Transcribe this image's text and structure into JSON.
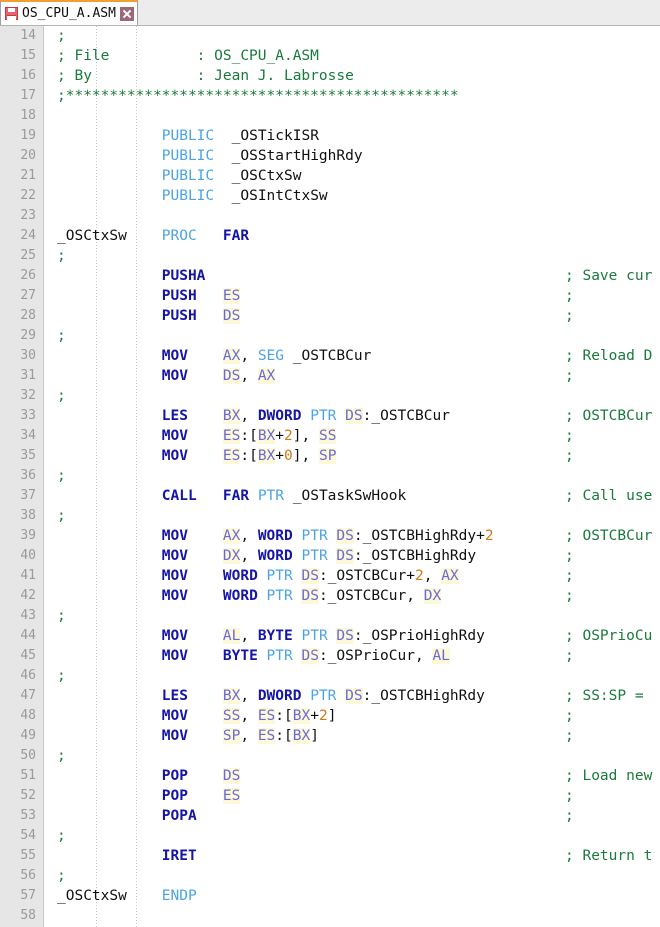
{
  "tab": {
    "label": "OS_CPU_A.ASM",
    "icon": "floppy-disk-icon",
    "close_icon": "close-icon",
    "modified": true
  },
  "colors": {
    "comment": "#1a7a3c",
    "directive": "#4ba3e3",
    "mnemonic": "#1515a8",
    "register_text": "#6a6ad6",
    "register_highlight": "#fcf8d8",
    "number": "#d07a1a",
    "identifier": "#101010",
    "gutter_bg": "#e6e6e6",
    "gutter_fg": "#9a9a9a",
    "tab_active_border": "#f0a030",
    "editor_bg": "#ffffff"
  },
  "editor": {
    "first_line": 14,
    "last_line": 58,
    "line_height": 20,
    "lines": [
      {
        "n": 14,
        "tokens": [
          {
            "t": ";",
            "c": "com"
          }
        ]
      },
      {
        "n": 15,
        "tokens": [
          {
            "t": "; File          : OS_CPU_A.ASM",
            "c": "com"
          }
        ]
      },
      {
        "n": 16,
        "tokens": [
          {
            "t": "; By            : Jean J. Labrosse",
            "c": "com"
          }
        ]
      },
      {
        "n": 17,
        "tokens": [
          {
            "t": ";*********************************************",
            "c": "com"
          }
        ]
      },
      {
        "n": 18,
        "tokens": []
      },
      {
        "n": 19,
        "tokens": [
          {
            "t": "            ",
            "c": "pun"
          },
          {
            "t": "PUBLIC",
            "c": "dir"
          },
          {
            "t": "  ",
            "c": "pun"
          },
          {
            "t": "_OSTickISR",
            "c": "id"
          }
        ]
      },
      {
        "n": 20,
        "tokens": [
          {
            "t": "            ",
            "c": "pun"
          },
          {
            "t": "PUBLIC",
            "c": "dir"
          },
          {
            "t": "  ",
            "c": "pun"
          },
          {
            "t": "_OSStartHighRdy",
            "c": "id"
          }
        ]
      },
      {
        "n": 21,
        "tokens": [
          {
            "t": "            ",
            "c": "pun"
          },
          {
            "t": "PUBLIC",
            "c": "dir"
          },
          {
            "t": "  ",
            "c": "pun"
          },
          {
            "t": "_OSCtxSw",
            "c": "id"
          }
        ]
      },
      {
        "n": 22,
        "tokens": [
          {
            "t": "            ",
            "c": "pun"
          },
          {
            "t": "PUBLIC",
            "c": "dir"
          },
          {
            "t": "  ",
            "c": "pun"
          },
          {
            "t": "_OSIntCtxSw",
            "c": "id"
          }
        ]
      },
      {
        "n": 23,
        "tokens": []
      },
      {
        "n": 24,
        "tokens": [
          {
            "t": "_OSCtxSw",
            "c": "id"
          },
          {
            "t": "    ",
            "c": "pun"
          },
          {
            "t": "PROC",
            "c": "dir"
          },
          {
            "t": "   ",
            "c": "pun"
          },
          {
            "t": "FAR",
            "c": "mn"
          }
        ]
      },
      {
        "n": 25,
        "tokens": [
          {
            "t": ";",
            "c": "com"
          }
        ]
      },
      {
        "n": 26,
        "tokens": [
          {
            "t": "            ",
            "c": "pun"
          },
          {
            "t": "PUSHA",
            "c": "mn"
          }
        ],
        "comment": "; Save cur"
      },
      {
        "n": 27,
        "tokens": [
          {
            "t": "            ",
            "c": "pun"
          },
          {
            "t": "PUSH",
            "c": "mn"
          },
          {
            "t": "   ",
            "c": "pun"
          },
          {
            "t": "ES",
            "c": "reg"
          }
        ],
        "comment": ";"
      },
      {
        "n": 28,
        "tokens": [
          {
            "t": "            ",
            "c": "pun"
          },
          {
            "t": "PUSH",
            "c": "mn"
          },
          {
            "t": "   ",
            "c": "pun"
          },
          {
            "t": "DS",
            "c": "reg"
          }
        ],
        "comment": ";"
      },
      {
        "n": 29,
        "tokens": [
          {
            "t": ";",
            "c": "com"
          }
        ]
      },
      {
        "n": 30,
        "tokens": [
          {
            "t": "            ",
            "c": "pun"
          },
          {
            "t": "MOV",
            "c": "mn"
          },
          {
            "t": "    ",
            "c": "pun"
          },
          {
            "t": "AX",
            "c": "reg"
          },
          {
            "t": ", ",
            "c": "pun"
          },
          {
            "t": "SEG",
            "c": "dir"
          },
          {
            "t": " ",
            "c": "pun"
          },
          {
            "t": "_OSTCBCur",
            "c": "id"
          }
        ],
        "comment": "; Reload D"
      },
      {
        "n": 31,
        "tokens": [
          {
            "t": "            ",
            "c": "pun"
          },
          {
            "t": "MOV",
            "c": "mn"
          },
          {
            "t": "    ",
            "c": "pun"
          },
          {
            "t": "DS",
            "c": "reg"
          },
          {
            "t": ", ",
            "c": "pun"
          },
          {
            "t": "AX",
            "c": "reg"
          }
        ],
        "comment": ";"
      },
      {
        "n": 32,
        "tokens": [
          {
            "t": ";",
            "c": "com"
          }
        ]
      },
      {
        "n": 33,
        "tokens": [
          {
            "t": "            ",
            "c": "pun"
          },
          {
            "t": "LES",
            "c": "mn"
          },
          {
            "t": "    ",
            "c": "pun"
          },
          {
            "t": "BX",
            "c": "reg"
          },
          {
            "t": ", ",
            "c": "pun"
          },
          {
            "t": "DWORD",
            "c": "mn"
          },
          {
            "t": " ",
            "c": "pun"
          },
          {
            "t": "PTR",
            "c": "dir"
          },
          {
            "t": " ",
            "c": "pun"
          },
          {
            "t": "DS",
            "c": "reg"
          },
          {
            "t": ":_OSTCBCur",
            "c": "id"
          }
        ],
        "comment": "; OSTCBCur"
      },
      {
        "n": 34,
        "tokens": [
          {
            "t": "            ",
            "c": "pun"
          },
          {
            "t": "MOV",
            "c": "mn"
          },
          {
            "t": "    ",
            "c": "pun"
          },
          {
            "t": "ES",
            "c": "reg"
          },
          {
            "t": ":[",
            "c": "pun"
          },
          {
            "t": "BX",
            "c": "reg"
          },
          {
            "t": "+",
            "c": "pun"
          },
          {
            "t": "2",
            "c": "num"
          },
          {
            "t": "], ",
            "c": "pun"
          },
          {
            "t": "SS",
            "c": "reg"
          }
        ],
        "comment": ";"
      },
      {
        "n": 35,
        "tokens": [
          {
            "t": "            ",
            "c": "pun"
          },
          {
            "t": "MOV",
            "c": "mn"
          },
          {
            "t": "    ",
            "c": "pun"
          },
          {
            "t": "ES",
            "c": "reg"
          },
          {
            "t": ":[",
            "c": "pun"
          },
          {
            "t": "BX",
            "c": "reg"
          },
          {
            "t": "+",
            "c": "pun"
          },
          {
            "t": "0",
            "c": "num"
          },
          {
            "t": "], ",
            "c": "pun"
          },
          {
            "t": "SP",
            "c": "reg"
          }
        ],
        "comment": ";"
      },
      {
        "n": 36,
        "tokens": [
          {
            "t": ";",
            "c": "com"
          }
        ]
      },
      {
        "n": 37,
        "tokens": [
          {
            "t": "            ",
            "c": "pun"
          },
          {
            "t": "CALL",
            "c": "mn"
          },
          {
            "t": "   ",
            "c": "pun"
          },
          {
            "t": "FAR",
            "c": "mn"
          },
          {
            "t": " ",
            "c": "pun"
          },
          {
            "t": "PTR",
            "c": "dir"
          },
          {
            "t": " ",
            "c": "pun"
          },
          {
            "t": "_OSTaskSwHook",
            "c": "id"
          }
        ],
        "comment": "; Call use"
      },
      {
        "n": 38,
        "tokens": [
          {
            "t": ";",
            "c": "com"
          }
        ]
      },
      {
        "n": 39,
        "tokens": [
          {
            "t": "            ",
            "c": "pun"
          },
          {
            "t": "MOV",
            "c": "mn"
          },
          {
            "t": "    ",
            "c": "pun"
          },
          {
            "t": "AX",
            "c": "reg"
          },
          {
            "t": ", ",
            "c": "pun"
          },
          {
            "t": "WORD",
            "c": "mn"
          },
          {
            "t": " ",
            "c": "pun"
          },
          {
            "t": "PTR",
            "c": "dir"
          },
          {
            "t": " ",
            "c": "pun"
          },
          {
            "t": "DS",
            "c": "reg"
          },
          {
            "t": ":_OSTCBHighRdy+",
            "c": "id"
          },
          {
            "t": "2",
            "c": "num"
          }
        ],
        "comment": "; OSTCBCur"
      },
      {
        "n": 40,
        "tokens": [
          {
            "t": "            ",
            "c": "pun"
          },
          {
            "t": "MOV",
            "c": "mn"
          },
          {
            "t": "    ",
            "c": "pun"
          },
          {
            "t": "DX",
            "c": "reg"
          },
          {
            "t": ", ",
            "c": "pun"
          },
          {
            "t": "WORD",
            "c": "mn"
          },
          {
            "t": " ",
            "c": "pun"
          },
          {
            "t": "PTR",
            "c": "dir"
          },
          {
            "t": " ",
            "c": "pun"
          },
          {
            "t": "DS",
            "c": "reg"
          },
          {
            "t": ":_OSTCBHighRdy",
            "c": "id"
          }
        ],
        "comment": ";"
      },
      {
        "n": 41,
        "tokens": [
          {
            "t": "            ",
            "c": "pun"
          },
          {
            "t": "MOV",
            "c": "mn"
          },
          {
            "t": "    ",
            "c": "pun"
          },
          {
            "t": "WORD",
            "c": "mn"
          },
          {
            "t": " ",
            "c": "pun"
          },
          {
            "t": "PTR",
            "c": "dir"
          },
          {
            "t": " ",
            "c": "pun"
          },
          {
            "t": "DS",
            "c": "reg"
          },
          {
            "t": ":_OSTCBCur+",
            "c": "id"
          },
          {
            "t": "2",
            "c": "num"
          },
          {
            "t": ", ",
            "c": "pun"
          },
          {
            "t": "AX",
            "c": "reg"
          }
        ],
        "comment": ";"
      },
      {
        "n": 42,
        "tokens": [
          {
            "t": "            ",
            "c": "pun"
          },
          {
            "t": "MOV",
            "c": "mn"
          },
          {
            "t": "    ",
            "c": "pun"
          },
          {
            "t": "WORD",
            "c": "mn"
          },
          {
            "t": " ",
            "c": "pun"
          },
          {
            "t": "PTR",
            "c": "dir"
          },
          {
            "t": " ",
            "c": "pun"
          },
          {
            "t": "DS",
            "c": "reg"
          },
          {
            "t": ":_OSTCBCur, ",
            "c": "id"
          },
          {
            "t": "DX",
            "c": "reg"
          }
        ],
        "comment": ";"
      },
      {
        "n": 43,
        "tokens": [
          {
            "t": ";",
            "c": "com"
          }
        ]
      },
      {
        "n": 44,
        "tokens": [
          {
            "t": "            ",
            "c": "pun"
          },
          {
            "t": "MOV",
            "c": "mn"
          },
          {
            "t": "    ",
            "c": "pun"
          },
          {
            "t": "AL",
            "c": "reg"
          },
          {
            "t": ", ",
            "c": "pun"
          },
          {
            "t": "BYTE",
            "c": "mn"
          },
          {
            "t": " ",
            "c": "pun"
          },
          {
            "t": "PTR",
            "c": "dir"
          },
          {
            "t": " ",
            "c": "pun"
          },
          {
            "t": "DS",
            "c": "reg"
          },
          {
            "t": ":_OSPrioHighRdy",
            "c": "id"
          }
        ],
        "comment": "; OSPrioCu"
      },
      {
        "n": 45,
        "tokens": [
          {
            "t": "            ",
            "c": "pun"
          },
          {
            "t": "MOV",
            "c": "mn"
          },
          {
            "t": "    ",
            "c": "pun"
          },
          {
            "t": "BYTE",
            "c": "mn"
          },
          {
            "t": " ",
            "c": "pun"
          },
          {
            "t": "PTR",
            "c": "dir"
          },
          {
            "t": " ",
            "c": "pun"
          },
          {
            "t": "DS",
            "c": "reg"
          },
          {
            "t": ":_OSPrioCur, ",
            "c": "id"
          },
          {
            "t": "AL",
            "c": "reg"
          }
        ],
        "comment": ";"
      },
      {
        "n": 46,
        "tokens": [
          {
            "t": ";",
            "c": "com"
          }
        ]
      },
      {
        "n": 47,
        "tokens": [
          {
            "t": "            ",
            "c": "pun"
          },
          {
            "t": "LES",
            "c": "mn"
          },
          {
            "t": "    ",
            "c": "pun"
          },
          {
            "t": "BX",
            "c": "reg"
          },
          {
            "t": ", ",
            "c": "pun"
          },
          {
            "t": "DWORD",
            "c": "mn"
          },
          {
            "t": " ",
            "c": "pun"
          },
          {
            "t": "PTR",
            "c": "dir"
          },
          {
            "t": " ",
            "c": "pun"
          },
          {
            "t": "DS",
            "c": "reg"
          },
          {
            "t": ":_OSTCBHighRdy",
            "c": "id"
          }
        ],
        "comment": "; SS:SP ="
      },
      {
        "n": 48,
        "tokens": [
          {
            "t": "            ",
            "c": "pun"
          },
          {
            "t": "MOV",
            "c": "mn"
          },
          {
            "t": "    ",
            "c": "pun"
          },
          {
            "t": "SS",
            "c": "reg"
          },
          {
            "t": ", ",
            "c": "pun"
          },
          {
            "t": "ES",
            "c": "reg"
          },
          {
            "t": ":[",
            "c": "pun"
          },
          {
            "t": "BX",
            "c": "reg"
          },
          {
            "t": "+",
            "c": "pun"
          },
          {
            "t": "2",
            "c": "num"
          },
          {
            "t": "]",
            "c": "pun"
          }
        ],
        "comment": ";"
      },
      {
        "n": 49,
        "tokens": [
          {
            "t": "            ",
            "c": "pun"
          },
          {
            "t": "MOV",
            "c": "mn"
          },
          {
            "t": "    ",
            "c": "pun"
          },
          {
            "t": "SP",
            "c": "reg"
          },
          {
            "t": ", ",
            "c": "pun"
          },
          {
            "t": "ES",
            "c": "reg"
          },
          {
            "t": ":[",
            "c": "pun"
          },
          {
            "t": "BX",
            "c": "reg"
          },
          {
            "t": "]",
            "c": "pun"
          }
        ],
        "comment": ";"
      },
      {
        "n": 50,
        "tokens": [
          {
            "t": ";",
            "c": "com"
          }
        ]
      },
      {
        "n": 51,
        "tokens": [
          {
            "t": "            ",
            "c": "pun"
          },
          {
            "t": "POP",
            "c": "mn"
          },
          {
            "t": "    ",
            "c": "pun"
          },
          {
            "t": "DS",
            "c": "reg"
          }
        ],
        "comment": "; Load new"
      },
      {
        "n": 52,
        "tokens": [
          {
            "t": "            ",
            "c": "pun"
          },
          {
            "t": "POP",
            "c": "mn"
          },
          {
            "t": "    ",
            "c": "pun"
          },
          {
            "t": "ES",
            "c": "reg"
          }
        ],
        "comment": ";"
      },
      {
        "n": 53,
        "tokens": [
          {
            "t": "            ",
            "c": "pun"
          },
          {
            "t": "POPA",
            "c": "mn"
          }
        ],
        "comment": ";"
      },
      {
        "n": 54,
        "tokens": [
          {
            "t": ";",
            "c": "com"
          }
        ]
      },
      {
        "n": 55,
        "tokens": [
          {
            "t": "            ",
            "c": "pun"
          },
          {
            "t": "IRET",
            "c": "mn"
          }
        ],
        "comment": "; Return t"
      },
      {
        "n": 56,
        "tokens": [
          {
            "t": ";",
            "c": "com"
          }
        ]
      },
      {
        "n": 57,
        "tokens": [
          {
            "t": "_OSCtxSw",
            "c": "id"
          },
          {
            "t": "    ",
            "c": "pun"
          },
          {
            "t": "ENDP",
            "c": "dir"
          }
        ]
      },
      {
        "n": 58,
        "tokens": []
      }
    ]
  }
}
